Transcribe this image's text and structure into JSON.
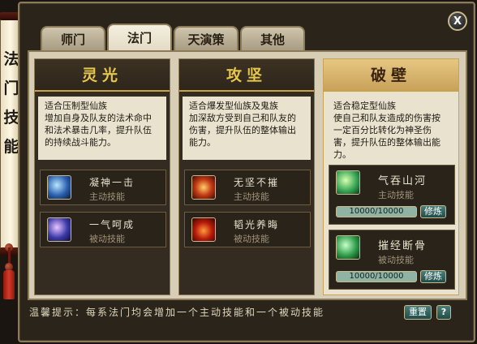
{
  "side_title": "法门技能",
  "close_label": "X",
  "tabs": [
    {
      "label": "师门"
    },
    {
      "label": "法门"
    },
    {
      "label": "天演策"
    },
    {
      "label": "其他"
    }
  ],
  "columns": [
    {
      "title": "灵光",
      "description": "适合压制型仙族\n增加自身及队友的法术命中和法术暴击几率，提升队伍的持续战斗能力。",
      "skills": [
        {
          "name": "凝神一击",
          "type": "主动技能",
          "icon": "ningshen-icon"
        },
        {
          "name": "一气呵成",
          "type": "被动技能",
          "icon": "yiqi-icon"
        }
      ]
    },
    {
      "title": "攻坚",
      "description": "适合爆发型仙族及鬼族\n加深敌方受到自己和队友的伤害，提升队伍的整体输出能力。",
      "skills": [
        {
          "name": "无坚不摧",
          "type": "主动技能",
          "icon": "wujian-icon"
        },
        {
          "name": "韬光养晦",
          "type": "被动技能",
          "icon": "taoguang-icon"
        }
      ]
    },
    {
      "title": "破壁",
      "description": "适合稳定型仙族\n使自己和队友造成的伤害按一定百分比转化为神圣伤害，提升队伍的整体输出能力。",
      "skills": [
        {
          "name": "气吞山河",
          "type": "主动技能",
          "icon": "qitun-icon",
          "progress": "10000/10000",
          "train_label": "修炼"
        },
        {
          "name": "摧经断骨",
          "type": "被动技能",
          "icon": "cuijing-icon",
          "progress": "10000/10000",
          "train_label": "修炼"
        }
      ]
    }
  ],
  "footer": {
    "tip": "温馨提示：每系法门均会增加一个主动技能和一个被动技能",
    "reset_label": "重置",
    "help_label": "?"
  }
}
